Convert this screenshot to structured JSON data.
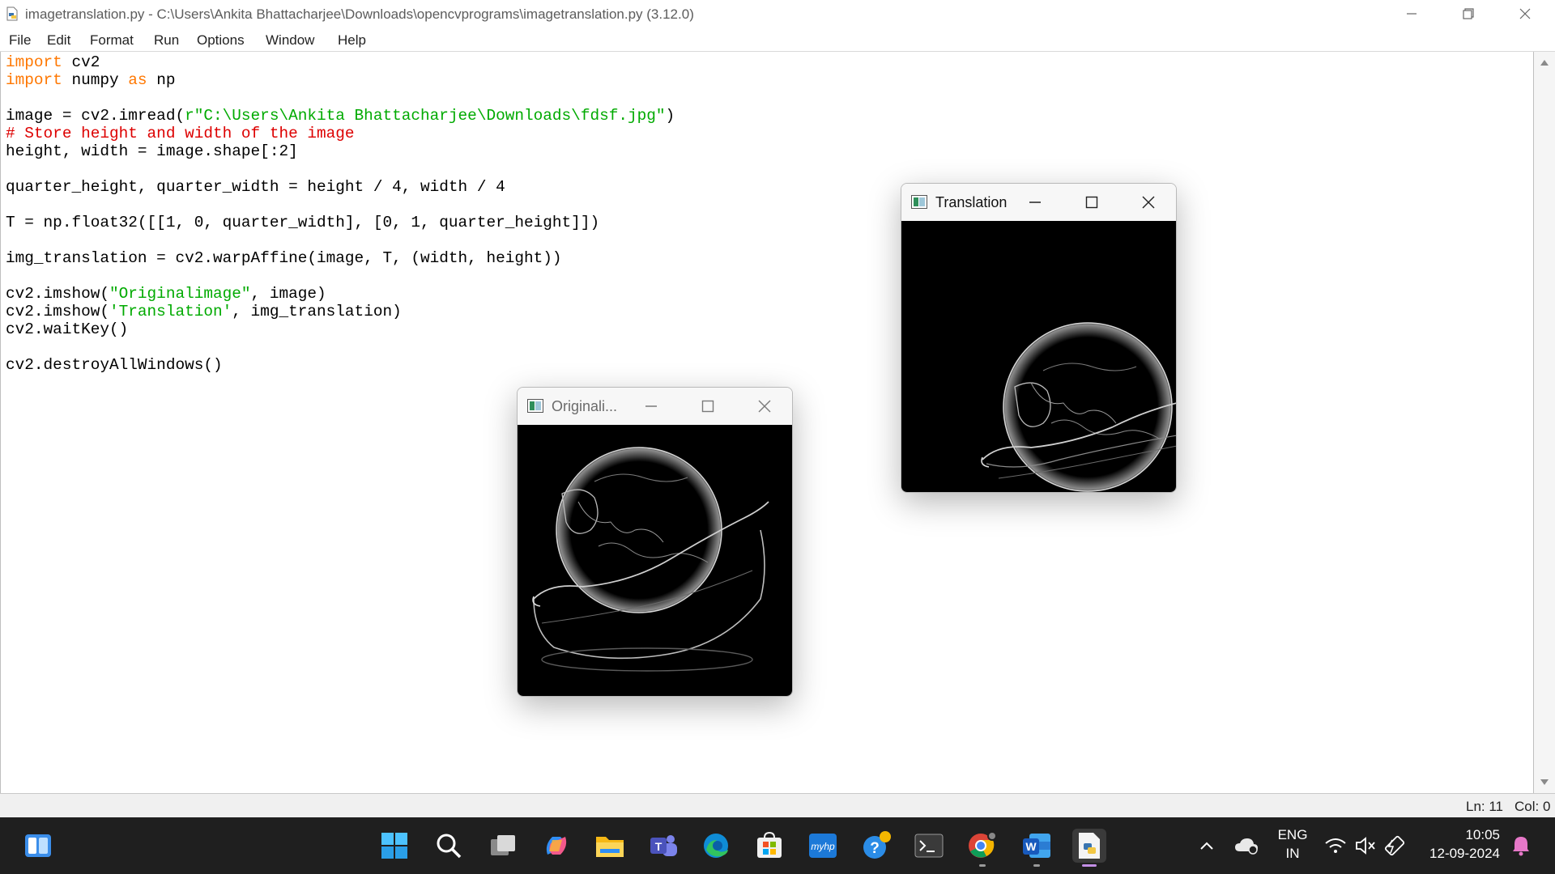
{
  "window": {
    "title": "imagetranslation.py - C:\\Users\\Ankita Bhattacharjee\\Downloads\\opencvprograms\\imagetranslation.py (3.12.0)"
  },
  "menu": [
    "File",
    "Edit",
    "Format",
    "Run",
    "Options",
    "Window",
    "Help"
  ],
  "code": {
    "l1_kw": "import",
    "l1_rest": " cv2",
    "l2_kw": "import",
    "l2_mid": " numpy ",
    "l2_kw2": "as",
    "l2_rest": " np",
    "l4_pre": "image = cv2.imread(",
    "l4_str": "r\"C:\\Users\\Ankita Bhattacharjee\\Downloads\\fdsf.jpg\"",
    "l4_post": ")",
    "l5_cm": "# Store height and width of the image",
    "l6": "height, width = image.shape[:2]",
    "l8": "quarter_height, quarter_width = height / 4, width / 4",
    "l10": "T = np.float32([[1, 0, quarter_width], [0, 1, quarter_height]])",
    "l12": "img_translation = cv2.warpAffine(image, T, (width, height))",
    "l14_pre": "cv2.imshow(",
    "l14_str": "\"Originalimage\"",
    "l14_post": ", image)",
    "l15_pre": "cv2.imshow(",
    "l15_str": "'Translation'",
    "l15_post": ", img_translation)",
    "l16": "cv2.waitKey()",
    "l18": "cv2.destroyAllWindows()"
  },
  "status": {
    "line": "Ln: 11",
    "col": "Col: 0"
  },
  "translation_window": {
    "title": "Translation"
  },
  "original_window": {
    "title": "Originali..."
  },
  "tray": {
    "lang_top": "ENG",
    "lang_bottom": "IN",
    "time": "10:05",
    "date": "12-09-2024"
  },
  "colors": {
    "keyword": "#ff7700",
    "string": "#00aa00",
    "comment": "#dd0000",
    "taskbar": "#1f1f1f"
  },
  "taskbar_icons": [
    "widgets-icon",
    "start-icon",
    "search-icon",
    "task-view-icon",
    "copilot-icon",
    "file-explorer-icon",
    "teams-icon",
    "edge-icon",
    "store-icon",
    "myhp-icon",
    "get-help-icon",
    "terminal-icon",
    "chrome-icon",
    "word-icon",
    "python-idle-icon"
  ],
  "taskbar_labels": {
    "myhp": "myhp",
    "word": "W"
  }
}
